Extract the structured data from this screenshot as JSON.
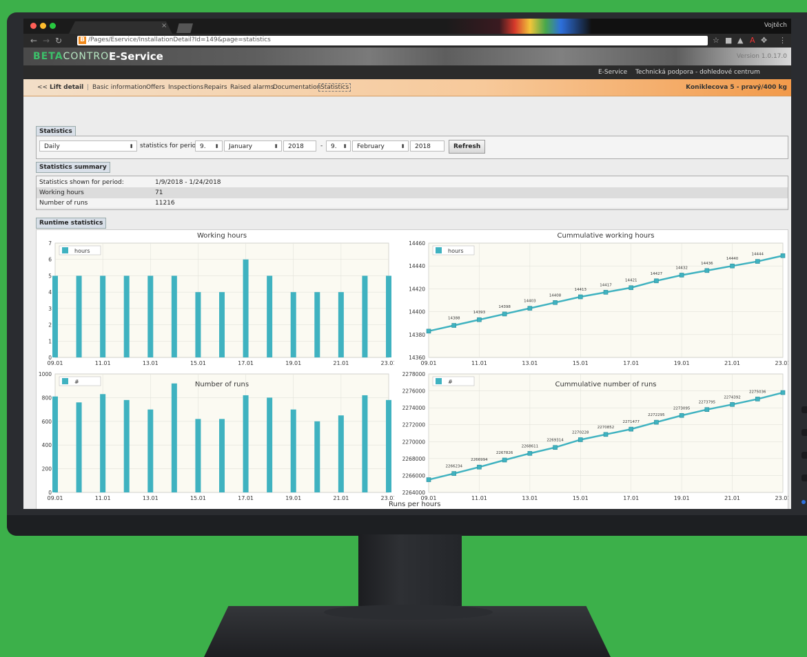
{
  "browser": {
    "user": "Vojtěch",
    "url": "/Pages/Eservice/InstallationDetail?Id=149&page=statistics",
    "tab_close": "×"
  },
  "app": {
    "logo_bold": "BETA",
    "logo_light": "CONTROL",
    "service": "E-Service",
    "version": "Version 1.0.17.0",
    "menu": [
      "E-Service",
      "Technická podpora - dohledové centrum"
    ]
  },
  "crumbs": {
    "back": "<<",
    "title": "Lift detail",
    "sep": "|",
    "tabs": [
      "Basic information",
      "Offers",
      "Inspections",
      "Repairs",
      "Raised alarms",
      "Documentation",
      "Statistics"
    ],
    "location": "Koniklecova 5 - pravý/400 kg"
  },
  "statistics": {
    "heading": "Statistics",
    "granularity": "Daily",
    "period_label": "statistics for period",
    "from_day": "9.",
    "from_month": "January",
    "from_year": "2018",
    "dash": "-",
    "to_day": "9.",
    "to_month": "February",
    "to_year": "2018",
    "refresh": "Refresh"
  },
  "summary": {
    "heading": "Statistics summary",
    "rows": [
      {
        "label": "Statistics shown for period:",
        "value": "1/9/2018 - 1/24/2018"
      },
      {
        "label": "Working hours",
        "value": "71"
      },
      {
        "label": "Number of runs",
        "value": "11216"
      }
    ]
  },
  "runtime": {
    "heading": "Runtime statistics",
    "bottom_title": "Runs per hours"
  },
  "colors": {
    "series": "#3fb2c0",
    "orange": "#f29a4a"
  },
  "chart_data": [
    {
      "type": "bar",
      "title": "Working hours",
      "legend": "hours",
      "legend_position": "top-left",
      "x": [
        "09.01",
        "10.01",
        "11.01",
        "12.01",
        "13.01",
        "14.01",
        "15.01",
        "16.01",
        "17.01",
        "18.01",
        "19.01",
        "20.01",
        "21.01",
        "22.01",
        "23.01"
      ],
      "values": [
        5,
        5,
        5,
        5,
        5,
        5,
        4,
        4,
        6,
        5,
        4,
        4,
        4,
        5,
        5
      ],
      "xticks": [
        "09.01",
        "11.01",
        "13.01",
        "15.01",
        "17.01",
        "19.01",
        "21.01",
        "23.01"
      ],
      "ylim": [
        0,
        7
      ],
      "yticks": [
        "0",
        "1",
        "2",
        "3",
        "4",
        "5",
        "6",
        "7"
      ],
      "grid": true
    },
    {
      "type": "line",
      "title": "Cummulative working hours",
      "legend": "hours",
      "legend_position": "top-left",
      "values": [
        14383,
        14388,
        14393,
        14398,
        14403,
        14408,
        14413,
        14417,
        14421,
        14427,
        14432,
        14436,
        14440,
        14444,
        14449
      ],
      "labels": [
        "",
        "14388",
        "14393",
        "14398",
        "14403",
        "14408",
        "14413",
        "14417",
        "14421",
        "14427",
        "14432",
        "14436",
        "14440",
        "14444",
        ""
      ],
      "xticks": [
        "09.01",
        "11.01",
        "13.01",
        "15.01",
        "17.01",
        "19.01",
        "21.01",
        "23.01"
      ],
      "ylim": [
        14360,
        14460
      ],
      "yticks": [
        "14360",
        "14380",
        "14400",
        "14420",
        "14440",
        "14460"
      ],
      "grid": true
    },
    {
      "type": "bar",
      "title": "Number of runs",
      "legend": "#",
      "legend_position": "top-left",
      "values": [
        810,
        760,
        830,
        780,
        700,
        920,
        620,
        620,
        820,
        800,
        700,
        600,
        650,
        820,
        780
      ],
      "xticks": [
        "09.01",
        "11.01",
        "13.01",
        "15.01",
        "17.01",
        "19.01",
        "21.01",
        "23.01"
      ],
      "ylim": [
        0,
        1000
      ],
      "yticks": [
        "0",
        "200",
        "400",
        "600",
        "800",
        "1000"
      ],
      "grid": true
    },
    {
      "type": "line",
      "title": "Cummulative number of runs",
      "legend": "#",
      "legend_position": "top-left",
      "values": [
        2265500,
        2266234,
        2266994,
        2267826,
        2268611,
        2269314,
        2270228,
        2270852,
        2271477,
        2272295,
        2273095,
        2273795,
        2274392,
        2275036,
        2275800
      ],
      "labels": [
        "",
        "2266234",
        "2266994",
        "2267826",
        "2268611",
        "2269314",
        "2270228",
        "2270852",
        "2271477",
        "2272295",
        "2273095",
        "2273795",
        "2274392",
        "2275036",
        ""
      ],
      "xticks": [
        "09.01",
        "11.01",
        "13.01",
        "15.01",
        "17.01",
        "19.01",
        "21.01",
        "23.01"
      ],
      "ylim": [
        2264000,
        2278000
      ],
      "yticks": [
        "2264000",
        "2266000",
        "2268000",
        "2270000",
        "2272000",
        "2274000",
        "2276000",
        "2278000"
      ],
      "grid": true
    }
  ]
}
